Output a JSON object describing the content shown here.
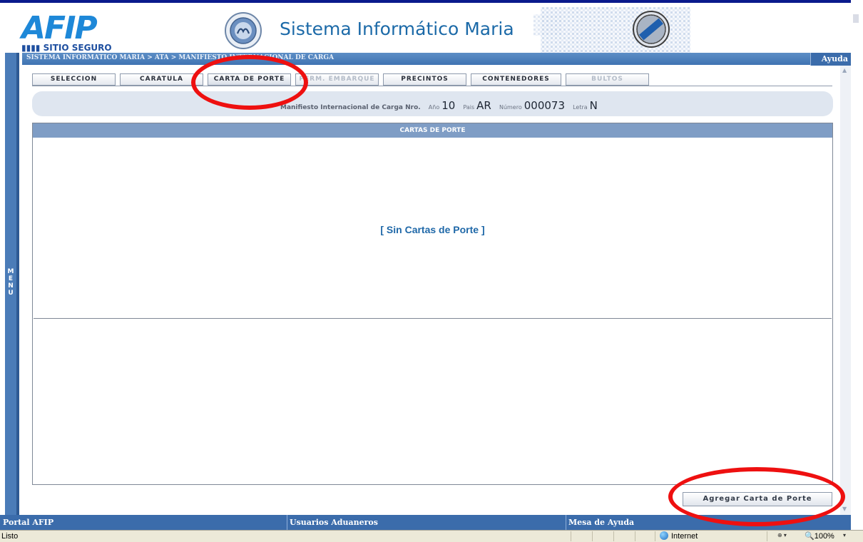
{
  "header": {
    "logo_word": "AFIP",
    "logo_subtitle": "SITIO SEGURO",
    "system_title": "Sistema Informático Maria"
  },
  "breadcrumb": "SISTEMA INFORMATICO MARIA > ATA > MANIFIESTO INTERNACIONAL DE CARGA",
  "help_label": "Ayuda",
  "side_menu_label": "MENU",
  "tabs": [
    {
      "label": "SELECCION",
      "state": "enabled"
    },
    {
      "label": "CARATULA",
      "state": "enabled"
    },
    {
      "label": "CARTA DE PORTE",
      "state": "active"
    },
    {
      "label": "PERM. EMBARQUE",
      "state": "disabled"
    },
    {
      "label": "PRECINTOS",
      "state": "enabled"
    },
    {
      "label": "CONTENEDORES",
      "state": "enabled"
    },
    {
      "label": "BULTOS",
      "state": "disabled"
    }
  ],
  "manifest": {
    "label": "Manifiesto Internacional de Carga Nro.",
    "year_label": "Año",
    "year": "10",
    "country_label": "Pais",
    "country": "AR",
    "number_label": "Número",
    "number": "000073",
    "letter_label": "Letra",
    "letter": "N"
  },
  "panel": {
    "title": "CARTAS DE PORTE",
    "empty_message": "[ Sin Cartas de Porte ]"
  },
  "add_button_label": "Agregar Carta de Porte",
  "footer": {
    "portal": "Portal AFIP",
    "usuarios": "Usuarios Aduaneros",
    "mesa": "Mesa de Ayuda"
  },
  "statusbar": {
    "status": "Listo",
    "zone": "Internet",
    "zoom": "100%"
  },
  "colors": {
    "header_blue": "#3b6cab",
    "title_blue": "#1c6aa8",
    "annotation_red": "#ee1010"
  },
  "annotations": [
    "carta-de-porte-tab",
    "agregar-carta-de-porte-button"
  ]
}
